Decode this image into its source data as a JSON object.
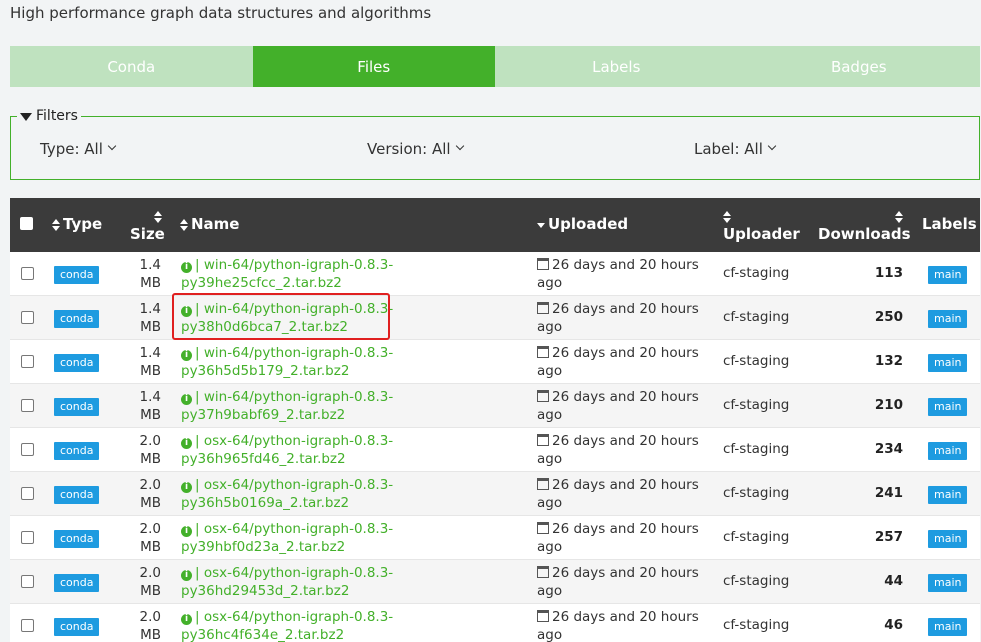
{
  "subtitle": "High performance graph data structures and algorithms",
  "tabs": [
    {
      "label": "Conda",
      "active": false
    },
    {
      "label": "Files",
      "active": true
    },
    {
      "label": "Labels",
      "active": false
    },
    {
      "label": "Badges",
      "active": false
    }
  ],
  "filters": {
    "legend": "Filters",
    "type": "Type: All",
    "version": "Version: All",
    "label": "Label: All"
  },
  "table": {
    "headers": {
      "type": "Type",
      "size": "Size",
      "name": "Name",
      "uploaded": "Uploaded",
      "uploader": "Uploader",
      "downloads": "Downloads",
      "labels": "Labels"
    },
    "rows": [
      {
        "type": "conda",
        "size1": "1.4",
        "size2": "MB",
        "name1": "| win-64/python-igraph-0.8.3-",
        "name2": "py39he25cfcc_2.tar.bz2",
        "uploaded1": "26 days and 20 hours",
        "uploaded2": "ago",
        "uploader": "cf-staging",
        "downloads": "113",
        "label": "main"
      },
      {
        "type": "conda",
        "size1": "1.4",
        "size2": "MB",
        "name1": "| win-64/python-igraph-0.8.3-",
        "name2": "py38h0d6bca7_2.tar.bz2",
        "uploaded1": "26 days and 20 hours",
        "uploaded2": "ago",
        "uploader": "cf-staging",
        "downloads": "250",
        "label": "main"
      },
      {
        "type": "conda",
        "size1": "1.4",
        "size2": "MB",
        "name1": "| win-64/python-igraph-0.8.3-",
        "name2": "py36h5d5b179_2.tar.bz2",
        "uploaded1": "26 days and 20 hours",
        "uploaded2": "ago",
        "uploader": "cf-staging",
        "downloads": "132",
        "label": "main"
      },
      {
        "type": "conda",
        "size1": "1.4",
        "size2": "MB",
        "name1": "| win-64/python-igraph-0.8.3-",
        "name2": "py37h9babf69_2.tar.bz2",
        "uploaded1": "26 days and 20 hours",
        "uploaded2": "ago",
        "uploader": "cf-staging",
        "downloads": "210",
        "label": "main"
      },
      {
        "type": "conda",
        "size1": "2.0",
        "size2": "MB",
        "name1": "| osx-64/python-igraph-0.8.3-",
        "name2": "py36h965fd46_2.tar.bz2",
        "uploaded1": "26 days and 20 hours",
        "uploaded2": "ago",
        "uploader": "cf-staging",
        "downloads": "234",
        "label": "main"
      },
      {
        "type": "conda",
        "size1": "2.0",
        "size2": "MB",
        "name1": "| osx-64/python-igraph-0.8.3-",
        "name2": "py36h5b0169a_2.tar.bz2",
        "uploaded1": "26 days and 20 hours",
        "uploaded2": "ago",
        "uploader": "cf-staging",
        "downloads": "241",
        "label": "main"
      },
      {
        "type": "conda",
        "size1": "2.0",
        "size2": "MB",
        "name1": "| osx-64/python-igraph-0.8.3-",
        "name2": "py39hbf0d23a_2.tar.bz2",
        "uploaded1": "26 days and 20 hours",
        "uploaded2": "ago",
        "uploader": "cf-staging",
        "downloads": "257",
        "label": "main"
      },
      {
        "type": "conda",
        "size1": "2.0",
        "size2": "MB",
        "name1": "| osx-64/python-igraph-0.8.3-",
        "name2": "py36hd29453d_2.tar.bz2",
        "uploaded1": "26 days and 20 hours",
        "uploaded2": "ago",
        "uploader": "cf-staging",
        "downloads": "44",
        "label": "main"
      },
      {
        "type": "conda",
        "size1": "2.0",
        "size2": "MB",
        "name1": "| osx-64/python-igraph-0.8.3-",
        "name2": "py36hc4f634e_2.tar.bz2",
        "uploaded1": "26 days and 20 hours",
        "uploaded2": "ago",
        "uploader": "cf-staging",
        "downloads": "46",
        "label": "main"
      }
    ]
  }
}
